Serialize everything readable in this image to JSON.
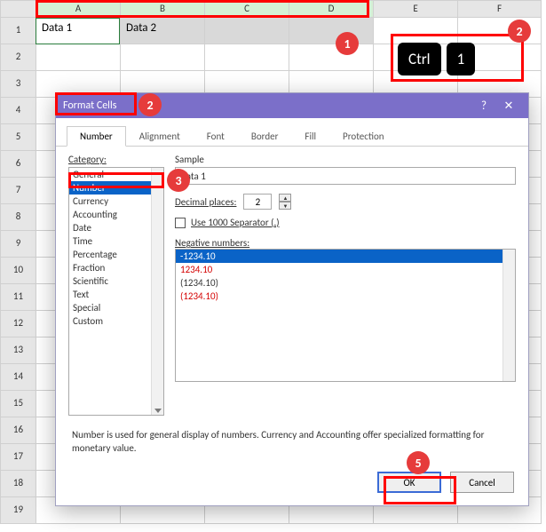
{
  "columns": [
    "A",
    "B",
    "C",
    "D",
    "E",
    "F"
  ],
  "row_numbers": [
    "1",
    "2",
    "3",
    "4",
    "5",
    "6",
    "7",
    "8",
    "9",
    "10",
    "11",
    "12",
    "13",
    "14",
    "15",
    "16",
    "17",
    "18",
    "19"
  ],
  "cells": {
    "A1": "Data 1",
    "B1": "Data 2"
  },
  "shortcut": {
    "key1": "Ctrl",
    "key2": "1"
  },
  "callouts": {
    "c1": "1",
    "c2top": "2",
    "c2dialog": "2",
    "c3": "3",
    "c5": "5"
  },
  "dialog": {
    "title": "Format Cells",
    "help_glyph": "?",
    "close_glyph": "✕",
    "tabs": [
      "Number",
      "Alignment",
      "Font",
      "Border",
      "Fill",
      "Protection"
    ],
    "category_label": "Category:",
    "categories": [
      "General",
      "Number",
      "Currency",
      "Accounting",
      "Date",
      "Time",
      "Percentage",
      "Fraction",
      "Scientific",
      "Text",
      "Special",
      "Custom"
    ],
    "sample_label": "Sample",
    "sample_value": "Data 1",
    "decimal_label": "Decimal places:",
    "decimal_value": "2",
    "separator_label": "Use 1000 Separator (,)",
    "negative_label": "Negative numbers:",
    "negative_options": [
      "-1234.10",
      "1234.10",
      "(1234.10)",
      "(1234.10)"
    ],
    "description": "Number is used for general display of numbers.  Currency and Accounting offer specialized formatting for monetary value.",
    "ok": "OK",
    "cancel": "Cancel"
  },
  "chart_data": null
}
